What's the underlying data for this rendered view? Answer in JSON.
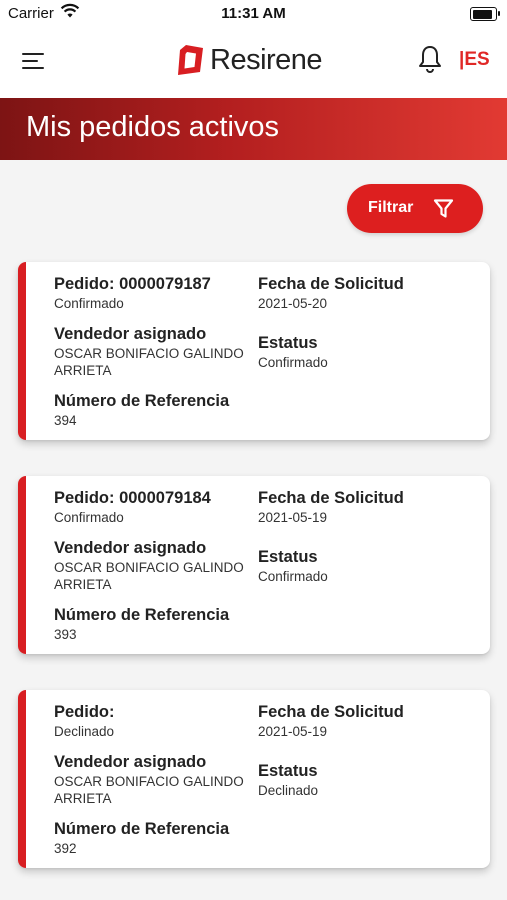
{
  "status_bar": {
    "carrier": "Carrier",
    "time": "11:31 AM"
  },
  "header": {
    "logo_text": "Resirene",
    "language": "|ES"
  },
  "banner": {
    "title": "Mis pedidos activos"
  },
  "filter": {
    "label": "Filtrar"
  },
  "labels": {
    "seller": "Vendedor asignado",
    "request_date": "Fecha de Solicitud",
    "status": "Estatus",
    "reference": "Número de Referencia"
  },
  "orders": [
    {
      "order_label": "Pedido: 0000079187",
      "order_status": "Confirmado",
      "request_date": "2021-05-20",
      "seller": "OSCAR BONIFACIO GALINDO ARRIETA",
      "status": "Confirmado",
      "reference": "394"
    },
    {
      "order_label": "Pedido: 0000079184",
      "order_status": "Confirmado",
      "request_date": "2021-05-19",
      "seller": "OSCAR BONIFACIO GALINDO ARRIETA",
      "status": "Confirmado",
      "reference": "393"
    },
    {
      "order_label": "Pedido:",
      "order_status": "Declinado",
      "request_date": "2021-05-19",
      "seller": "OSCAR BONIFACIO GALINDO ARRIETA",
      "status": "Declinado",
      "reference": "392"
    }
  ],
  "colors": {
    "brand_red": "#dd1f1f",
    "banner_dark": "#7d1414",
    "banner_light": "#e23a33"
  },
  "icons": {
    "menu": "menu-icon",
    "bell": "bell-icon",
    "filter": "filter-icon",
    "wifi": "wifi-icon",
    "battery": "battery-icon",
    "logo": "resirene-logo-mark"
  }
}
